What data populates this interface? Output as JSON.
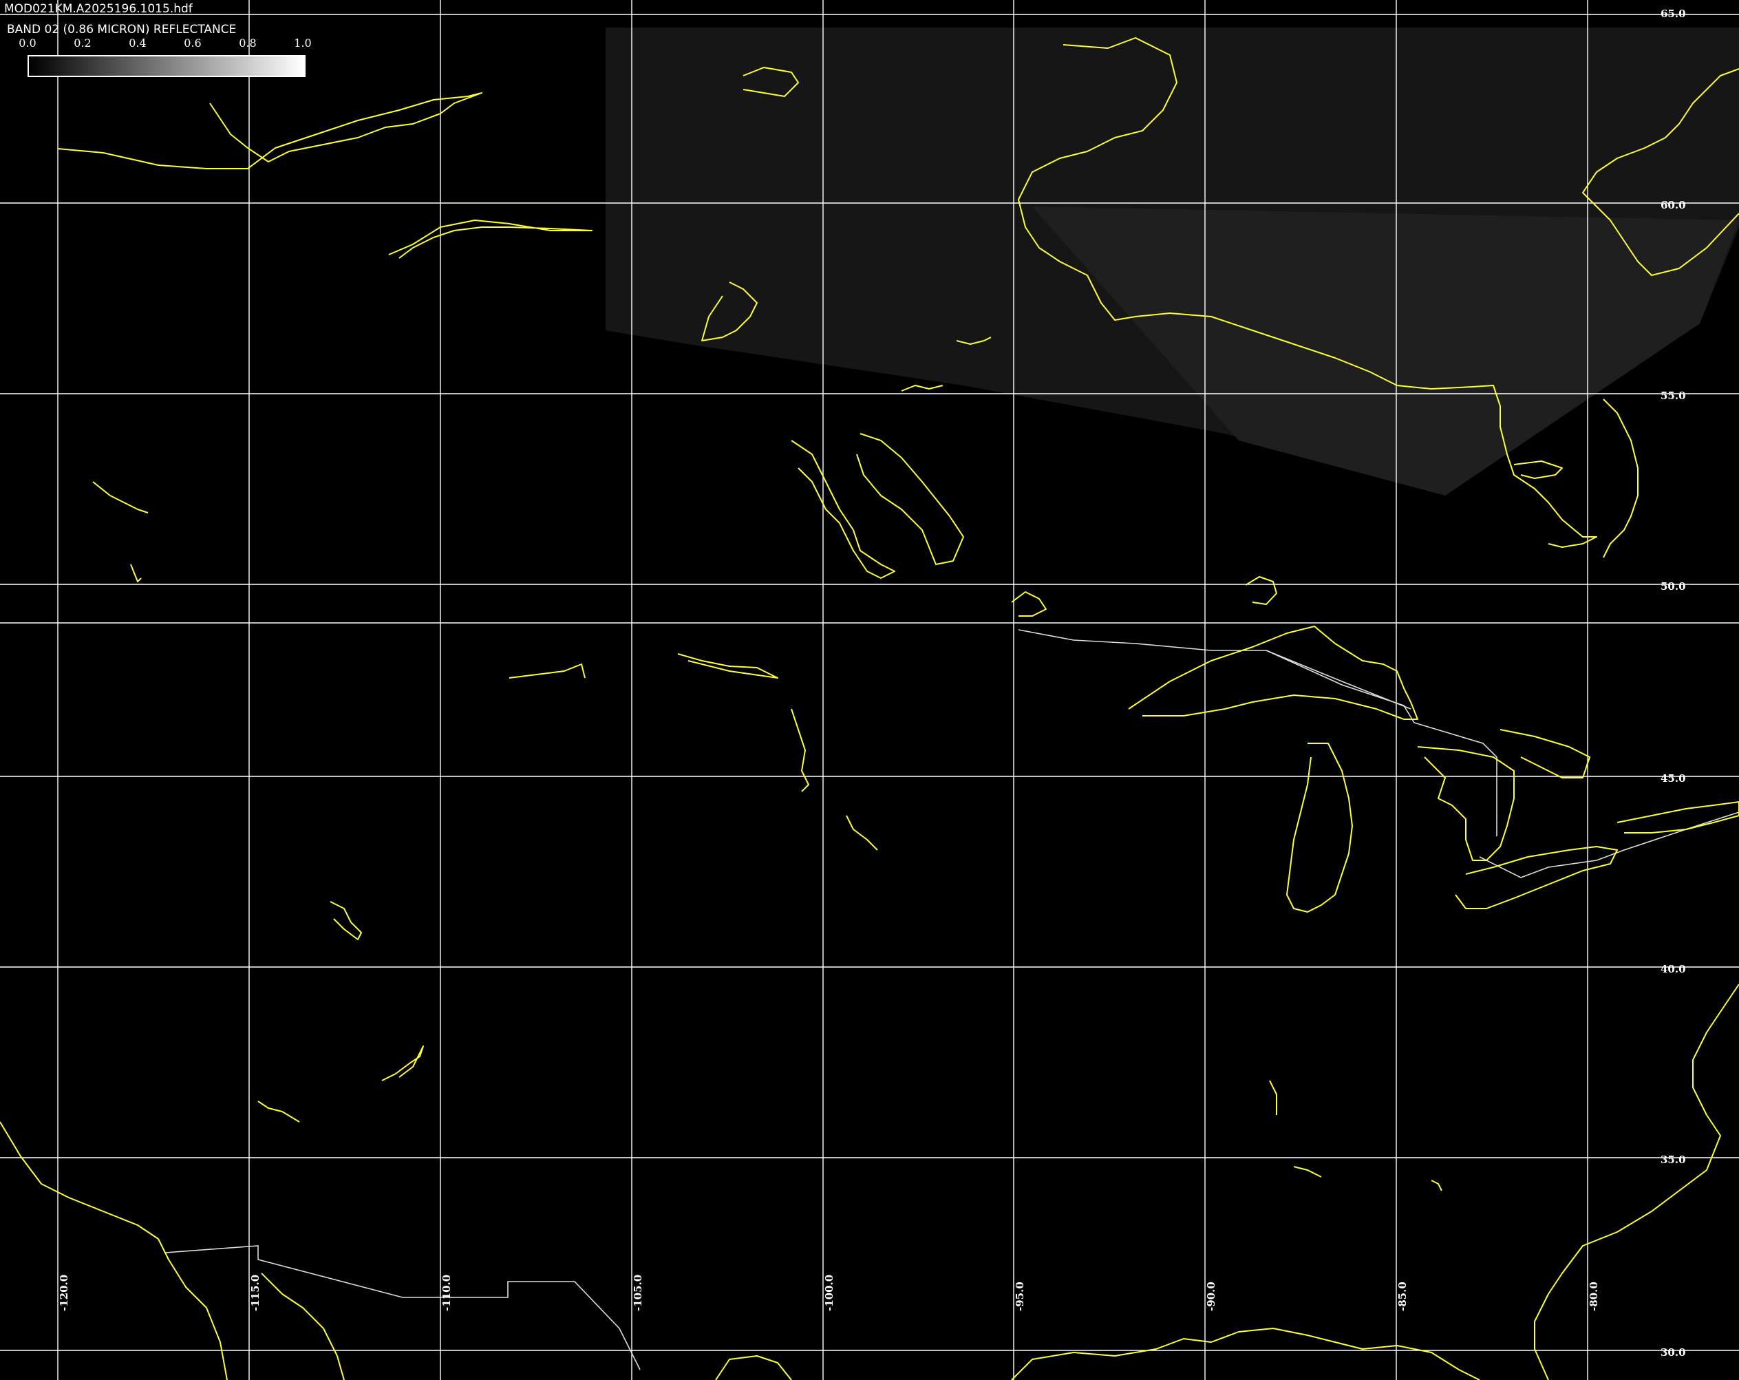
{
  "header": {
    "filename": "MOD021KM.A2025196.1015.hdf",
    "band_label": "BAND 02 (0.86 MICRON) REFLECTANCE"
  },
  "colorbar": {
    "ticks": [
      "0.0",
      "0.2",
      "0.4",
      "0.6",
      "0.8",
      "1.0"
    ],
    "range": [
      0.0,
      1.0
    ],
    "colormap": "grayscale"
  },
  "grid": {
    "lat_labels": [
      "65.0",
      "60.0",
      "55.0",
      "50.0",
      "45.0",
      "40.0",
      "35.0",
      "30.0"
    ],
    "lon_labels": [
      "-120.0",
      "-115.0",
      "-110.0",
      "-105.0",
      "-100.0",
      "-95.0",
      "-90.0",
      "-85.0",
      "-80.0"
    ]
  },
  "colors": {
    "background": "#000000",
    "grid": "#ffffff",
    "coastline": "#ffff33",
    "borders": "#dddddd",
    "swath": "#1a1a1a"
  }
}
